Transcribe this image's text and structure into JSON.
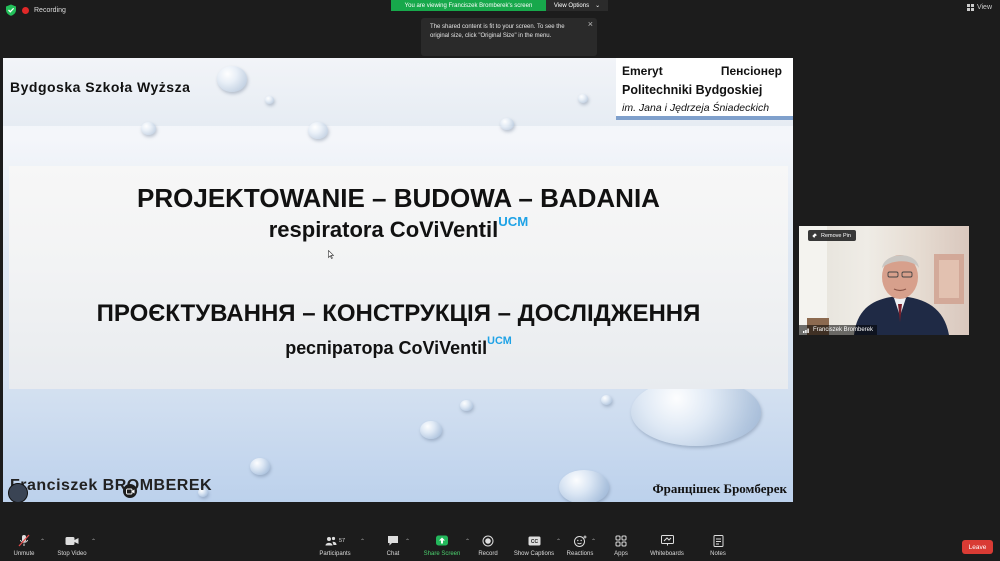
{
  "top": {
    "recording_label": "Recording",
    "banner": "You are viewing Franciszek Bromberek's screen",
    "view_options": "View Options",
    "view_label": "View"
  },
  "tooltip": {
    "text": "The shared content is fit to your screen. To see the original size, click \"Original Size\" in the menu."
  },
  "slide": {
    "university": "Bydgoska Szkoła Wyższa",
    "corner_word1": "Emeryt",
    "corner_word2": "Пенсіонер",
    "corner_line2": "Politechniki Bydgoskiej",
    "corner_line3": "im. Jana i Jędrzeja Śniadeckich",
    "title1": "PROJEKTOWANIE – BUDOWA – BADANIA",
    "title2_main": "respiratora CoViVentil",
    "title2_sup": "UCM",
    "title3": "ПРОЄКТУВАННЯ – КОНСТРУКЦІЯ – ДОСЛІДЖЕННЯ",
    "title4_main": "респіратора  CoViVentil",
    "title4_sup": "UCM",
    "author_pl": "Franciszek BROMBEREK",
    "author_ua": "Францішек Бромберек"
  },
  "video": {
    "remove_pin": "Remove Pin",
    "name": "Franciszek Bromberek"
  },
  "toolbar": {
    "unmute": "Unmute",
    "stop_video": "Stop Video",
    "participants": "Participants",
    "participants_count": "57",
    "chat": "Chat",
    "share_screen": "Share Screen",
    "record": "Record",
    "captions": "Show Captions",
    "reactions": "Reactions",
    "apps": "Apps",
    "whiteboards": "Whiteboards",
    "notes": "Notes",
    "leave": "Leave"
  },
  "colors": {
    "share_green": "#17a84b",
    "leave_red": "#d93b34",
    "ucm_blue": "#1ea2e6"
  }
}
